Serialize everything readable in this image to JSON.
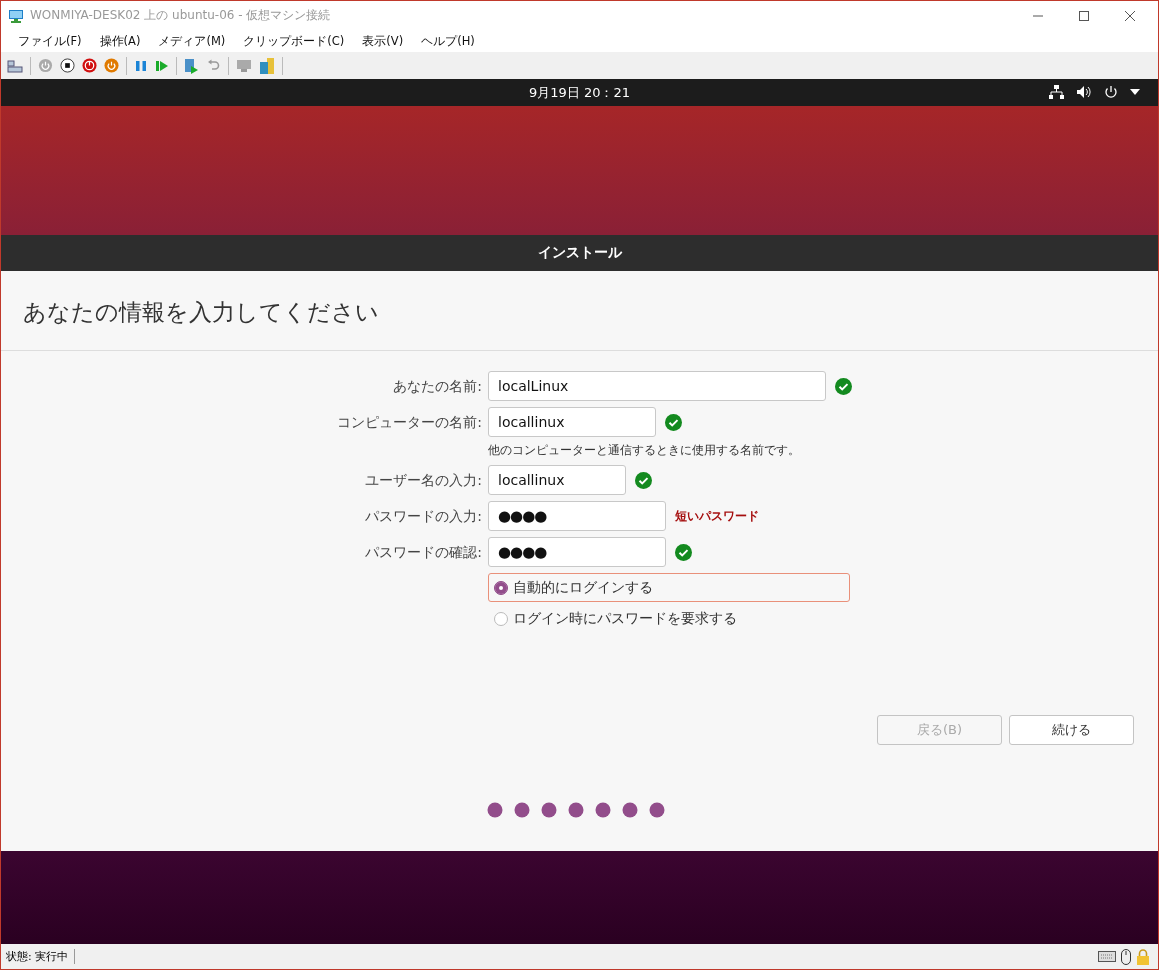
{
  "window": {
    "title": "WONMIYA-DESK02 上の ubuntu-06 - 仮想マシン接続"
  },
  "menu": [
    "ファイル(F)",
    "操作(A)",
    "メディア(M)",
    "クリップボード(C)",
    "表示(V)",
    "ヘルプ(H)"
  ],
  "guest_top_bar": {
    "clock": "9月19日 20：21"
  },
  "installer": {
    "title": "インストール",
    "heading": "あなたの情報を入力してください",
    "fields": [
      {
        "label": "あなたの名前:",
        "value": "localLinux",
        "valid": true
      },
      {
        "label": "コンピューターの名前:",
        "value": "locallinux",
        "valid": true,
        "hint": "他のコンピューターと通信するときに使用する名前です。"
      },
      {
        "label": "ユーザー名の入力:",
        "value": "locallinux",
        "valid": true
      },
      {
        "label": "パスワードの入力:",
        "value": "●●●●",
        "valid": false,
        "error": "短いパスワード"
      },
      {
        "label": "パスワードの確認:",
        "value": "●●●●",
        "valid": true
      }
    ],
    "login_options": [
      {
        "label": "自動的にログインする",
        "selected": true,
        "focused": true
      },
      {
        "label": "ログイン時にパスワードを要求する",
        "selected": false,
        "focused": false
      }
    ],
    "buttons": [
      {
        "label": "戻る(B)",
        "disabled": true
      },
      {
        "label": "続ける",
        "disabled": false
      }
    ]
  },
  "status_bar": {
    "status": "状態: 実行中"
  }
}
